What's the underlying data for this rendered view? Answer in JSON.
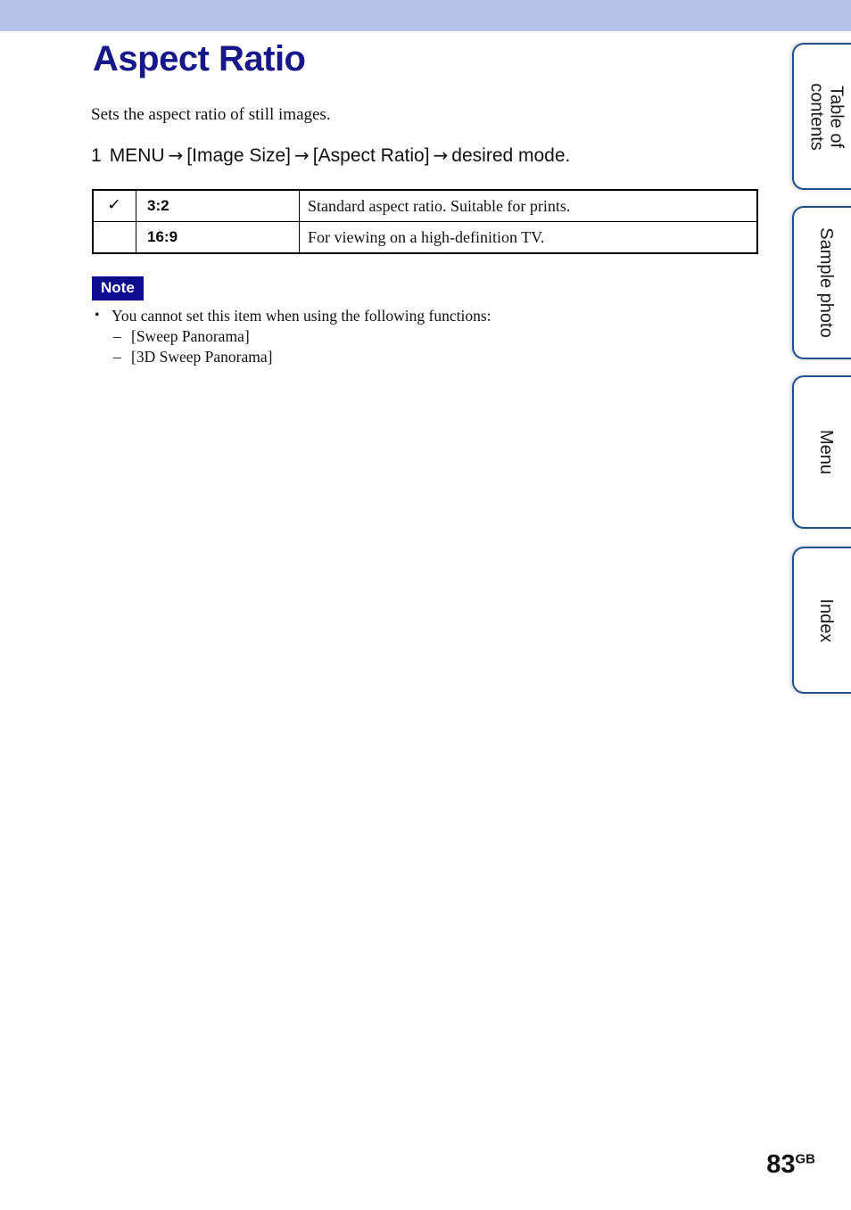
{
  "page": {
    "title": "Aspect Ratio",
    "intro": "Sets the aspect ratio of still images.",
    "number": "83",
    "number_suffix": "GB"
  },
  "step": {
    "index": "1",
    "menu_label": "MENU",
    "arrow": "→",
    "part1": "[Image Size]",
    "part2": "[Aspect Ratio]",
    "part3": "desired mode."
  },
  "options_table": {
    "check_glyph": "✓",
    "rows": [
      {
        "checked": true,
        "check": "✓",
        "name": "3:2",
        "description": "Standard aspect ratio. Suitable for prints."
      },
      {
        "checked": false,
        "check": "",
        "name": "16:9",
        "description": "For viewing on a high-definition TV."
      }
    ]
  },
  "note": {
    "badge_label": "Note",
    "bullets": [
      "You cannot set this item when using the following functions:"
    ],
    "sub_items": [
      "[Sweep Panorama]",
      "[3D Sweep Panorama]"
    ]
  },
  "side_tabs": [
    {
      "label": "Table of contents"
    },
    {
      "label": "Sample photo"
    },
    {
      "label": "Menu"
    },
    {
      "label": "Index"
    }
  ],
  "colors": {
    "band": "#b7c4ea",
    "title_navy": "#17178b",
    "note_navy": "#0c0c8d",
    "tab_border": "#1f4e8c"
  }
}
